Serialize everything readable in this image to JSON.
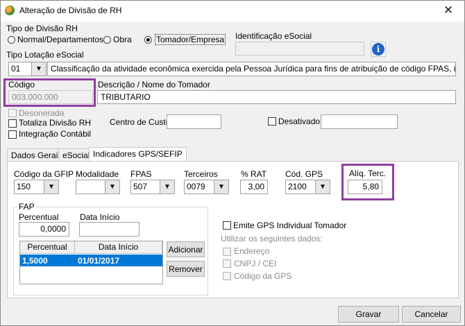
{
  "window": {
    "title": "Alteração de Divisão de RH",
    "close_glyph": "✕"
  },
  "tipo_divisao": {
    "legend": "Tipo de Divisão RH",
    "options": [
      "Normal/Departamentos",
      "Obra",
      "Tomador/Empresa"
    ],
    "selected": "Tomador/Empresa"
  },
  "esocial_id": {
    "label": "Identificação eSocial",
    "value": "",
    "info_icon": "info-icon"
  },
  "lotacao": {
    "label": "Tipo Lotação eSocial",
    "code": "01",
    "description": "Classificação da atividade econômica exercida pela Pessoa Jurídica para fins de atribuição de código FPAS, inclusive obras"
  },
  "codigo": {
    "label": "Código",
    "value": "003.000.000"
  },
  "descricao": {
    "label": "Descrição / Nome do Tomador",
    "value": "TRIBUTARIO"
  },
  "checks": {
    "desonerada": "Desonerada",
    "totaliza": "Totaliza Divisão RH",
    "integracao": "Integração Contábil",
    "desativado": "Desativado"
  },
  "centro_custo": {
    "label": "Centro de Custo",
    "value": ""
  },
  "desativado_value": "",
  "tabs": [
    "Dados Gerais",
    "eSocial",
    "Indicadores GPS/SEFIP"
  ],
  "active_tab": "Indicadores GPS/SEFIP",
  "gps": {
    "codigo_gfip": {
      "label": "Código da GFIP",
      "value": "150"
    },
    "modalidade": {
      "label": "Modalidade",
      "value": ""
    },
    "fpas": {
      "label": "FPAS",
      "value": "507"
    },
    "terceiros": {
      "label": "Terceiros",
      "value": "0079"
    },
    "rat": {
      "label": "% RAT",
      "value": "3,00"
    },
    "cod_gps": {
      "label": "Cód. GPS",
      "value": "2100"
    },
    "aliq_terc": {
      "label": "Alíq. Terc.",
      "value": "5,80"
    }
  },
  "fap": {
    "legend": "FAP",
    "percentual_label": "Percentual",
    "percentual_value": "0,0000",
    "data_inicio_label": "Data Início",
    "data_inicio_value": "",
    "grid_headers": [
      "Percentual",
      "Data Início"
    ],
    "rows": [
      {
        "percentual": "1,5000",
        "data_inicio": "01/01/2017"
      }
    ],
    "add_button": "Adicionar",
    "remove_button": "Remover"
  },
  "emite_gps": {
    "label": "Emite GPS Individual Tomador",
    "utilizar_label": "Utilizar os seguintes dados:",
    "options": [
      "Endereço",
      "CNPJ / CEI",
      "Código da GPS"
    ]
  },
  "footer": {
    "gravar": "Gravar",
    "cancelar": "Cancelar"
  },
  "colors": {
    "highlight": "#8e3fa0",
    "selection": "#0078d7",
    "info": "#1e63c8"
  }
}
